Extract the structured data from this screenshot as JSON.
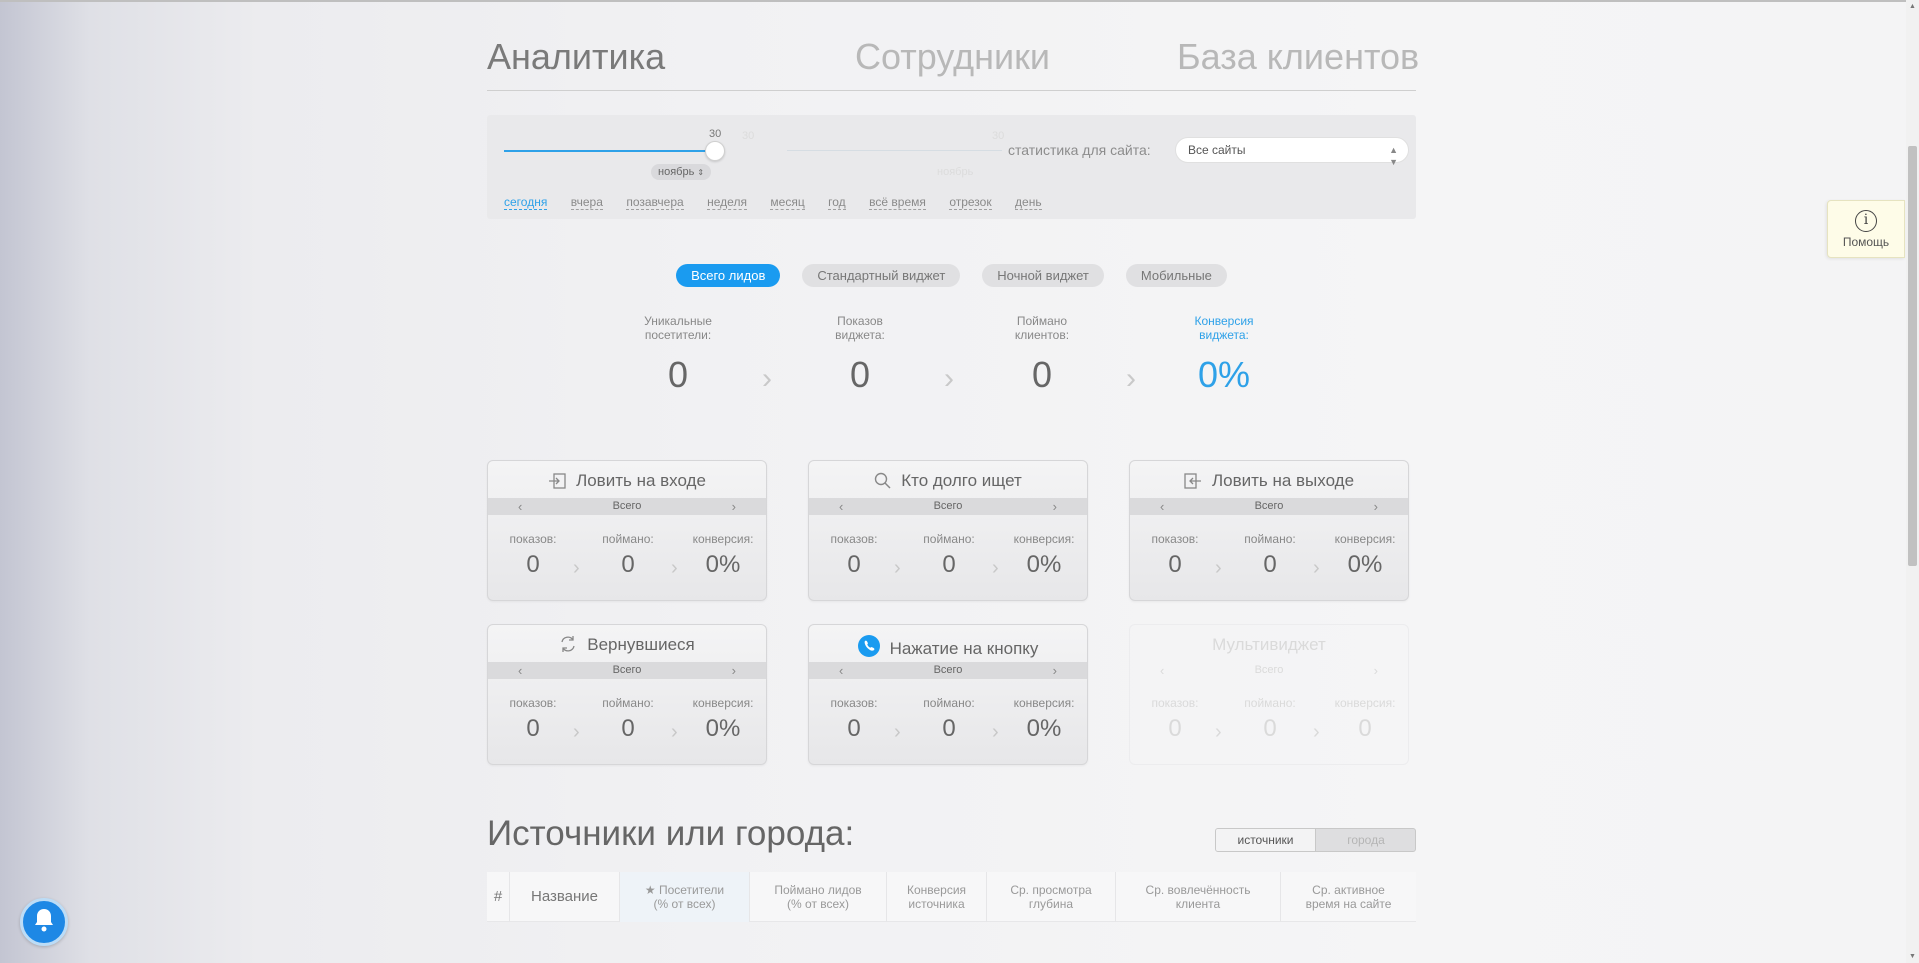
{
  "nav": {
    "tabs": [
      {
        "label": "Аналитика",
        "active": true
      },
      {
        "label": "Сотрудники",
        "active": false
      },
      {
        "label": "База клиентов",
        "active": false
      }
    ]
  },
  "filter": {
    "slider_value": "30",
    "slider_value_dim": "30",
    "slider_value_dim2": "30",
    "month": "ноябрь",
    "month_dim": "ноябрь",
    "site_label": "статистика для сайта:",
    "site_select": "Все сайты",
    "periods": [
      "сегодня",
      "вчера",
      "позавчера",
      "неделя",
      "месяц",
      "год",
      "всё время",
      "отрезок",
      "день"
    ],
    "active_period": "сегодня"
  },
  "segments": {
    "items": [
      "Всего лидов",
      "Стандартный виджет",
      "Ночной виджет",
      "Мобильные"
    ],
    "active": "Всего лидов"
  },
  "funnel": {
    "items": [
      {
        "label1": "Уникальные",
        "label2": "посетители:",
        "value": "0"
      },
      {
        "label1": "Показов",
        "label2": "виджета:",
        "value": "0"
      },
      {
        "label1": "Поймано",
        "label2": "клиентов:",
        "value": "0"
      },
      {
        "label1": "Конверсия",
        "label2": "виджета:",
        "value": "0%"
      }
    ],
    "accent_color": "#2ea1e8"
  },
  "card_labels": {
    "shows": "показов:",
    "caught": "поймано:",
    "conversion": "конверсия:",
    "filter": "Всего"
  },
  "cards": [
    {
      "title": "Ловить на входе",
      "icon": "enter-icon",
      "shows": "0",
      "caught": "0",
      "conversion": "0%"
    },
    {
      "title": "Кто долго ищет",
      "icon": "search-icon",
      "shows": "0",
      "caught": "0",
      "conversion": "0%"
    },
    {
      "title": "Ловить на выходе",
      "icon": "exit-icon",
      "shows": "0",
      "caught": "0",
      "conversion": "0%"
    },
    {
      "title": "Вернувшиеся",
      "icon": "refresh-icon",
      "shows": "0",
      "caught": "0",
      "conversion": "0%"
    },
    {
      "title": "Нажатие на кнопку",
      "icon": "phone-icon",
      "shows": "0",
      "caught": "0",
      "conversion": "0%"
    },
    {
      "title": "Мультивиджет",
      "icon": "",
      "shows": "0",
      "caught": "0",
      "conversion": "0",
      "disabled": true
    }
  ],
  "sources": {
    "title": "Источники или города:",
    "toggle": [
      "источники",
      "города"
    ],
    "active_toggle": "источники",
    "columns": [
      {
        "line1": "#",
        "line2": ""
      },
      {
        "line1": "Название",
        "line2": ""
      },
      {
        "line1": "★ Посетители",
        "line2": "(% от всех)"
      },
      {
        "line1": "Поймано лидов",
        "line2": "(% от всех)"
      },
      {
        "line1": "Конверсия",
        "line2": "источника"
      },
      {
        "line1": "Ср. просмотра",
        "line2": "глубина"
      },
      {
        "line1": "Ср. вовлечённость",
        "line2": "клиента"
      },
      {
        "line1": "Ср. активное",
        "line2": "время на сайте"
      }
    ]
  },
  "help": {
    "label": "Помощь",
    "icon": "info-icon"
  },
  "notifications": {
    "icon": "bell-icon"
  }
}
